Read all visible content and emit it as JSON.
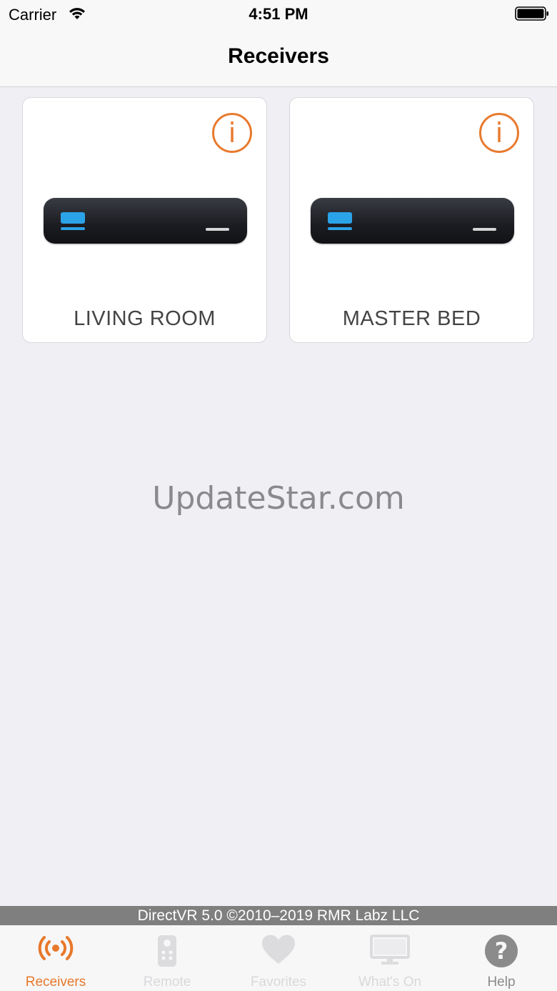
{
  "status_bar": {
    "carrier": "Carrier",
    "time": "4:51 PM",
    "wifi_icon": "wifi-icon",
    "battery_icon": "battery-icon"
  },
  "nav": {
    "title": "Receivers"
  },
  "receivers": [
    {
      "name": "LIVING ROOM",
      "info_icon": "info-icon"
    },
    {
      "name": "MASTER BED",
      "info_icon": "info-icon"
    }
  ],
  "watermark": "UpdateStar.com",
  "copyright": "DirectVR 5.0 ©2010–2019 RMR Labz LLC",
  "tabs": [
    {
      "label": "Receivers",
      "icon": "broadcast-icon",
      "active": true
    },
    {
      "label": "Remote",
      "icon": "remote-icon",
      "active": false
    },
    {
      "label": "Favorites",
      "icon": "heart-icon",
      "active": false
    },
    {
      "label": "What's On",
      "icon": "monitor-icon",
      "active": false
    },
    {
      "label": "Help",
      "icon": "question-icon",
      "active": false
    }
  ],
  "colors": {
    "accent": "#e8782a",
    "screen_blue": "#2ba3e8",
    "background": "#efeff4"
  }
}
